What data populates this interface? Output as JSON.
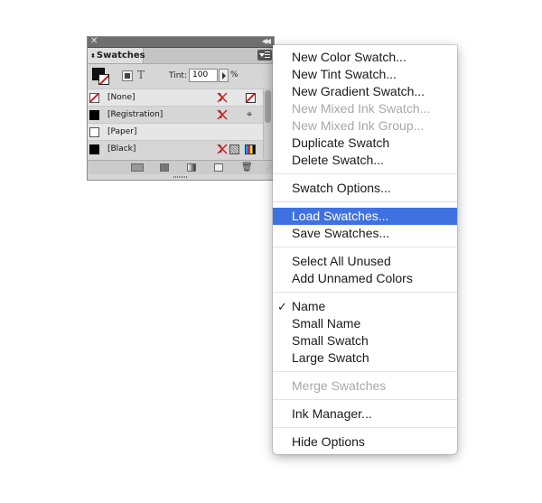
{
  "panel": {
    "title": "Swatches",
    "tint_label": "Tint:",
    "tint_value": "100",
    "tint_unit": "%",
    "text_toggle": "T",
    "swatches": [
      {
        "label": "[None]",
        "kind": "none"
      },
      {
        "label": "[Registration]",
        "kind": "black"
      },
      {
        "label": "[Paper]",
        "kind": "white"
      },
      {
        "label": "[Black]",
        "kind": "black"
      }
    ]
  },
  "menu": {
    "groups": [
      [
        "New Color Swatch...",
        "New Tint Swatch...",
        "New Gradient Swatch...",
        "New Mixed Ink Swatch...",
        "New Mixed Ink Group...",
        "Duplicate Swatch",
        "Delete Swatch..."
      ],
      [
        "Swatch Options..."
      ],
      [
        "Load Swatches...",
        "Save Swatches..."
      ],
      [
        "Select All Unused",
        "Add Unnamed Colors"
      ],
      [
        "Name",
        "Small Name",
        "Small Swatch",
        "Large Swatch"
      ],
      [
        "Merge Swatches"
      ],
      [
        "Ink Manager..."
      ],
      [
        "Hide Options"
      ]
    ],
    "disabled": [
      "New Mixed Ink Swatch...",
      "New Mixed Ink Group...",
      "Merge Swatches"
    ],
    "highlighted": "Load Swatches...",
    "checked": "Name",
    "checkmark": "✓"
  },
  "colors": {
    "highlight": "#3f72e0",
    "disabled_text": "#a8a8a8",
    "none_slash": "#d6161b"
  }
}
